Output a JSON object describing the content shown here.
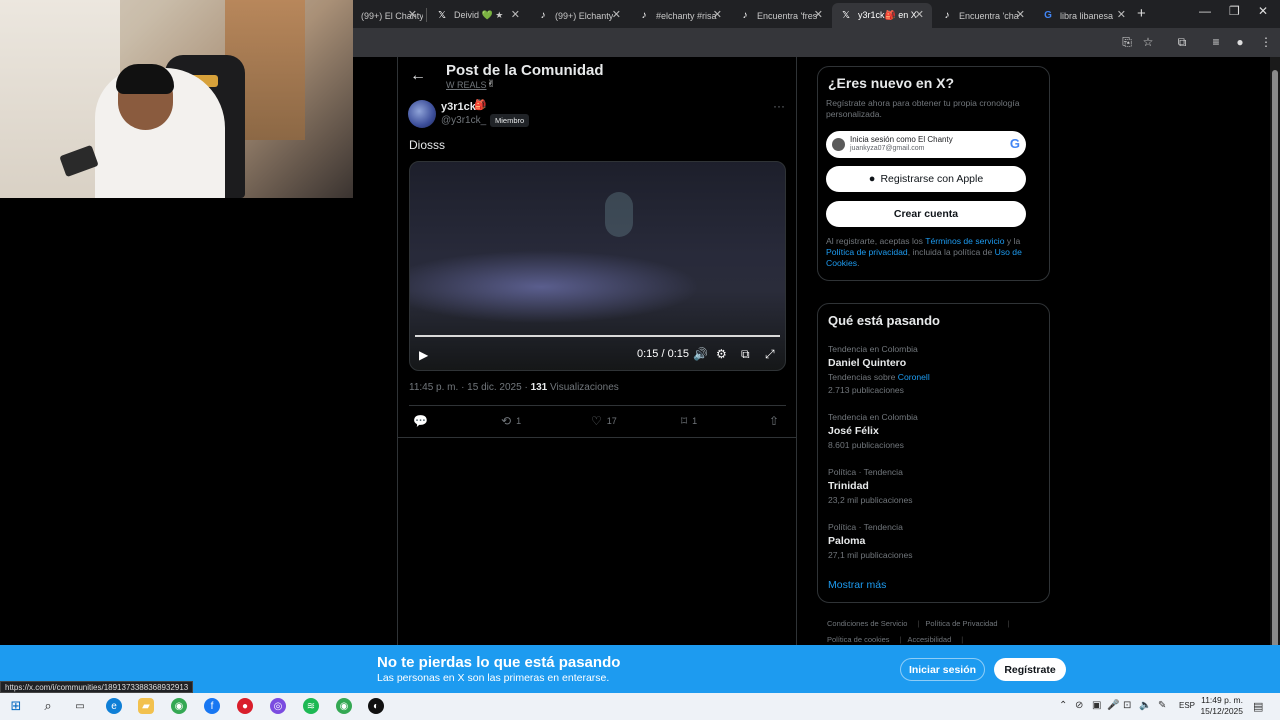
{
  "browser": {
    "tabs": [
      {
        "title": "(99+) El Chanty",
        "icon": "x-logo-icon",
        "active": false
      },
      {
        "title": "Deivid 💚 ★",
        "icon": "x-logo-icon",
        "active": false
      },
      {
        "title": "(99+) Elchanty",
        "icon": "tiktok-icon",
        "active": false
      },
      {
        "title": "#elchanty #risa",
        "icon": "tiktok-icon",
        "active": false
      },
      {
        "title": "Encuentra 'fres",
        "icon": "tiktok-icon",
        "active": false
      },
      {
        "title": "y3r1ck🎒 en X",
        "icon": "x-logo-icon",
        "active": true
      },
      {
        "title": "Encuentra 'cha",
        "icon": "tiktok-icon",
        "active": false
      },
      {
        "title": "libra libanesa",
        "icon": "google-icon",
        "active": false
      }
    ],
    "status_url": "https://x.com/i/communities/1891373388368932913"
  },
  "post": {
    "back_icon": "←",
    "page_title": "Post de la Comunidad",
    "community_name": "W REALS",
    "community_emoji": "✌",
    "author": {
      "name": "y3r1ck",
      "emoji": "🎒",
      "handle": "@y3r1ck_ ·",
      "badge": "Miembro"
    },
    "more_icon": "···",
    "text": "Diosss",
    "video": {
      "play_icon": "▶",
      "time": "0:15 / 0:15",
      "progress": 1.0
    },
    "meta": {
      "timestamp": "11:45 p. m. · 15 dic. 2025 ·",
      "views_count": "131",
      "views_label": "Visualizaciones"
    },
    "actions": {
      "reply_count": "",
      "repost_count": "1",
      "like_count": "17",
      "bookmark_count": "1"
    }
  },
  "sidebar": {
    "new_card": {
      "title": "¿Eres nuevo en X?",
      "subtitle": "Regístrate ahora para obtener tu propia cronología personalizada.",
      "google_name": "Inicia sesión como El Chanty",
      "google_email": "juankyza07@gmail.com",
      "google_logo": "G",
      "apple_label": "Registrarse con Apple",
      "create_label": "Crear cuenta",
      "legal_pre": "Al registrarte, aceptas los ",
      "legal_terms": "Términos de servicio",
      "legal_mid1": " y la ",
      "legal_privacy": "Política de privacidad",
      "legal_mid2": ", incluida la política de ",
      "legal_cookies": "Uso de Cookies",
      "legal_end": "."
    },
    "trends_card": {
      "title": "Qué está pasando",
      "items": [
        {
          "category": "Tendencia en Colombia",
          "name": "Daniel Quintero",
          "related_prefix": "Tendencias sobre ",
          "related_link": "Coronell",
          "posts": "2.713 publicaciones"
        },
        {
          "category": "Tendencia en Colombia",
          "name": "José Félix",
          "posts": "8.601 publicaciones"
        },
        {
          "category": "Política · Tendencia",
          "name": "Trinidad",
          "posts": "23,2 mil publicaciones"
        },
        {
          "category": "Política · Tendencia",
          "name": "Paloma",
          "posts": "27,1 mil publicaciones"
        }
      ],
      "show_more": "Mostrar más"
    },
    "footer": {
      "terms": "Condiciones de Servicio",
      "privacy": "Política de Privacidad",
      "cookies": "Política de cookies",
      "accessibility": "Accesibilidad"
    }
  },
  "banner": {
    "title": "No te pierdas lo que está pasando",
    "subtitle": "Las personas en X son las primeras en enterarse.",
    "login": "Iniciar sesión",
    "signup": "Regístrate"
  },
  "taskbar": {
    "lang": "ESP",
    "time": "11:49 p. m.",
    "date": "15/12/2025"
  },
  "colors": {
    "accent": "#1d9bf0",
    "background": "#000000",
    "text": "#e7e9ea",
    "muted": "#71767b"
  }
}
